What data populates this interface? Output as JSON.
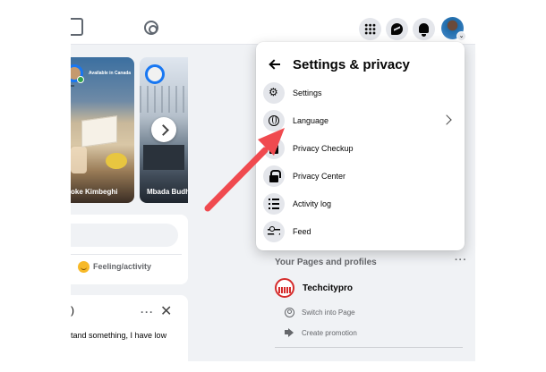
{
  "dropdown": {
    "title": "Settings & privacy",
    "items": [
      {
        "label": "Settings",
        "icon": "gear-icon"
      },
      {
        "label": "Language",
        "icon": "globe-icon",
        "has_submenu": true
      },
      {
        "label": "Privacy Checkup",
        "icon": "lock-check-icon"
      },
      {
        "label": "Privacy Center",
        "icon": "lock-icon"
      },
      {
        "label": "Activity log",
        "icon": "list-icon"
      },
      {
        "label": "Feed",
        "icon": "sliders-icon"
      }
    ]
  },
  "stories": [
    {
      "name": "oke Kimbeghi",
      "badge": "Available in Canada"
    },
    {
      "name": "Mbada Budh"
    }
  ],
  "composer": {
    "feeling_label": "Feeling/activity"
  },
  "post": {
    "fragment": ")",
    "text": "tand something, I have low"
  },
  "pages": {
    "heading": "Your Pages and profiles",
    "page_name": "Techcitypro",
    "actions": [
      {
        "label": "Switch into Page",
        "icon": "switch-profile-icon"
      },
      {
        "label": "Create promotion",
        "icon": "megaphone-icon"
      }
    ]
  },
  "colors": {
    "accent": "#1877f2",
    "annotation_arrow": "#f04a4f",
    "panel_bg": "#f0f2f5"
  }
}
